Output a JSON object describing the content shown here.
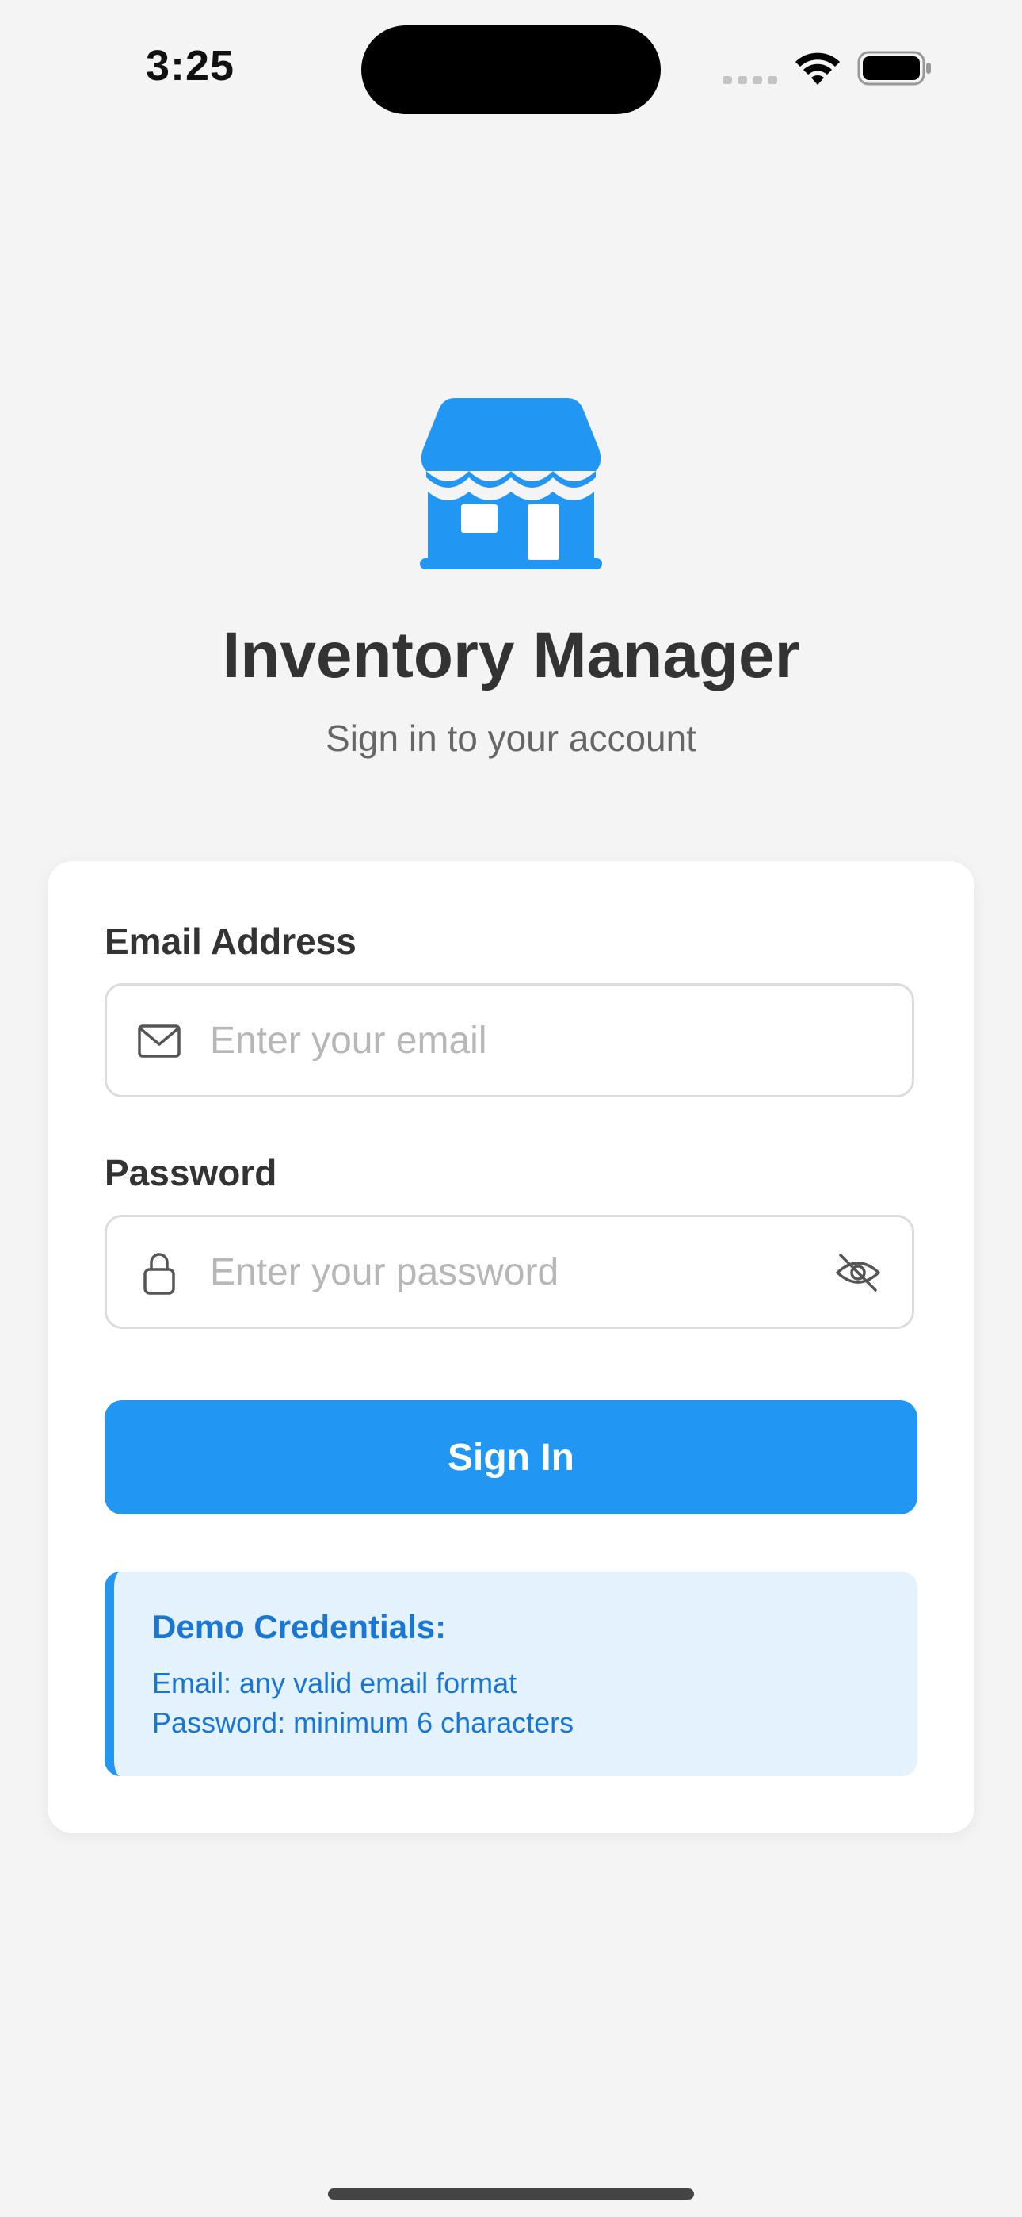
{
  "status_bar": {
    "time": "3:25"
  },
  "app": {
    "title": "Inventory Manager",
    "subtitle": "Sign in to your account",
    "logo_icon": "storefront-icon",
    "accent_color": "#2196F3"
  },
  "login_form": {
    "email": {
      "label": "Email Address",
      "placeholder": "Enter your email",
      "value": "",
      "icon": "mail-icon"
    },
    "password": {
      "label": "Password",
      "placeholder": "Enter your password",
      "value": "",
      "icon": "lock-icon",
      "toggle_icon": "eye-off-icon"
    },
    "submit_label": "Sign In"
  },
  "demo_credentials": {
    "title": "Demo Credentials:",
    "email_hint": "Email: any valid email format",
    "password_hint": "Password: minimum 6 characters"
  }
}
